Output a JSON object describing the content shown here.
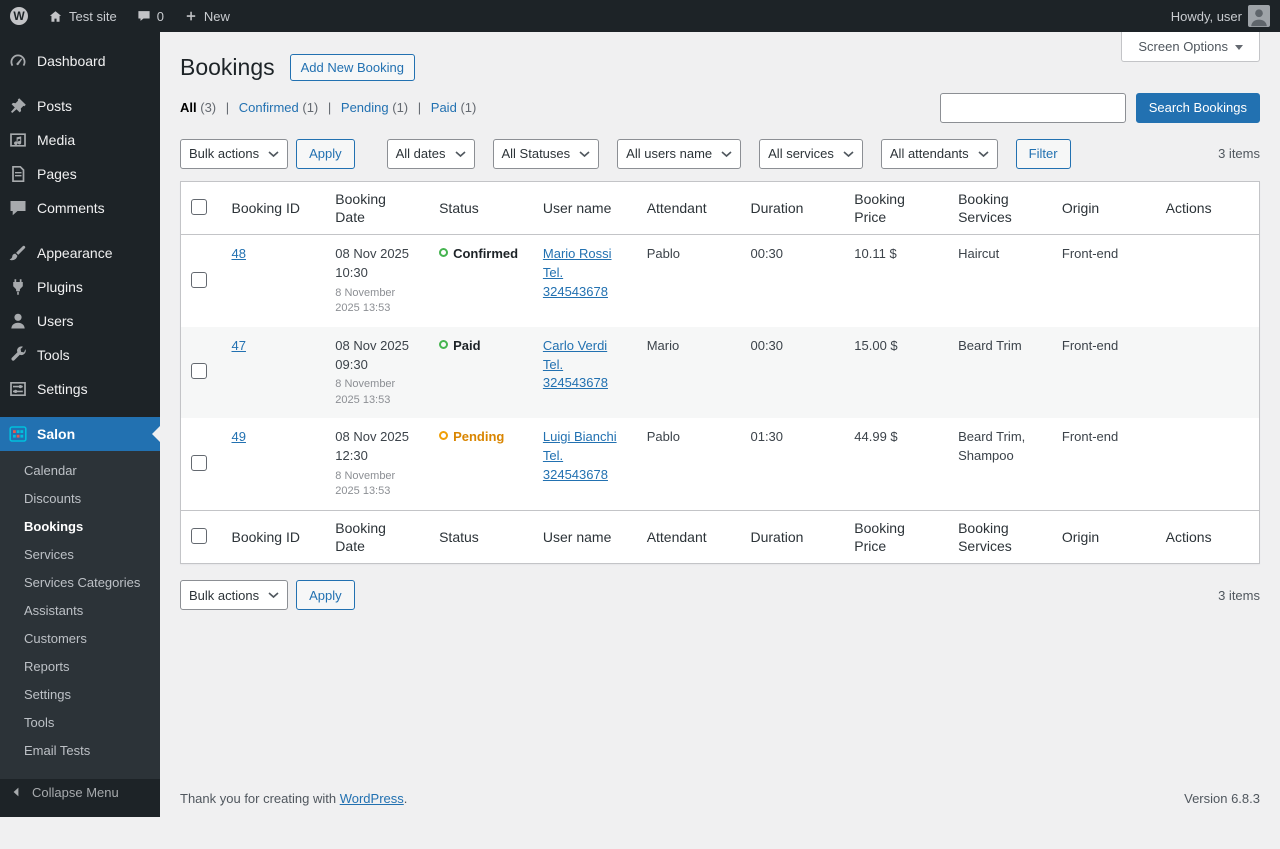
{
  "admin_bar": {
    "wp_logo_letter": "W",
    "site_name": "Test site",
    "comment_count": "0",
    "new_label": "New",
    "howdy": "Howdy, user"
  },
  "sidebar": {
    "items": [
      {
        "label": "Dashboard"
      },
      {
        "label": "Posts"
      },
      {
        "label": "Media"
      },
      {
        "label": "Pages"
      },
      {
        "label": "Comments"
      },
      {
        "label": "Appearance"
      },
      {
        "label": "Plugins"
      },
      {
        "label": "Users"
      },
      {
        "label": "Tools"
      },
      {
        "label": "Settings"
      }
    ],
    "salon_label": "Salon",
    "submenu": [
      "Calendar",
      "Discounts",
      "Bookings",
      "Services",
      "Services Categories",
      "Assistants",
      "Customers",
      "Reports",
      "Settings",
      "Tools",
      "Email Tests"
    ],
    "collapse_label": "Collapse Menu"
  },
  "header": {
    "title": "Bookings",
    "add_new_label": "Add New Booking",
    "screen_options_label": "Screen Options"
  },
  "views": {
    "separator": "|",
    "items": [
      {
        "label": "All",
        "count": "(3)",
        "current": true
      },
      {
        "label": "Confirmed",
        "count": "(1)",
        "current": false
      },
      {
        "label": "Pending",
        "count": "(1)",
        "current": false
      },
      {
        "label": "Paid",
        "count": "(1)",
        "current": false
      }
    ]
  },
  "search": {
    "value": "",
    "button_label": "Search Bookings"
  },
  "tablenav": {
    "bulk_actions_label": "Bulk actions",
    "apply_label": "Apply",
    "filters": [
      "All dates",
      "All Statuses",
      "All users name",
      "All services",
      "All attendants"
    ],
    "filter_button_label": "Filter",
    "items_count": "3 items"
  },
  "table": {
    "columns": [
      "Booking ID",
      "Booking Date",
      "Status",
      "User name",
      "Attendant",
      "Duration",
      "Booking Price",
      "Booking Services",
      "Origin",
      "Actions"
    ],
    "rows": [
      {
        "id": "48",
        "date": "08 Nov 2025 10:30",
        "created": "8 November 2025 13:53",
        "status": "Confirmed",
        "status_color": "green",
        "user": "Mario Rossi Tel. 324543678",
        "attendant": "Pablo",
        "duration": "00:30",
        "price": "10.11 $",
        "services": "Haircut",
        "origin": "Front-end"
      },
      {
        "id": "47",
        "date": "08 Nov 2025 09:30",
        "created": "8 November 2025 13:53",
        "status": "Paid",
        "status_color": "green",
        "user": "Carlo Verdi Tel. 324543678",
        "attendant": "Mario",
        "duration": "00:30",
        "price": "15.00 $",
        "services": "Beard Trim",
        "origin": "Front-end"
      },
      {
        "id": "49",
        "date": "08 Nov 2025 12:30",
        "created": "8 November 2025 13:53",
        "status": "Pending",
        "status_color": "orange",
        "user": "Luigi Bianchi Tel. 324543678",
        "attendant": "Pablo",
        "duration": "01:30",
        "price": "44.99 $",
        "services": "Beard Trim, Shampoo",
        "origin": "Front-end"
      }
    ]
  },
  "footer": {
    "thanks_prefix": "Thank you for creating with",
    "wordpress_link": "WordPress",
    "period": ".",
    "version": "Version 6.8.3"
  },
  "colors": {
    "accent_blue": "#2271b1",
    "status_green": "#46b450",
    "status_orange": "#f0a009",
    "pending_text": "#d98500",
    "sidebar_bg": "#1d2327",
    "submenu_bg": "#2c3338",
    "content_bg": "#f0f0f1",
    "table_border": "#c3c4c7",
    "salon_icon_teal": "#00c0de",
    "salon_icon_red": "#e8594f"
  }
}
